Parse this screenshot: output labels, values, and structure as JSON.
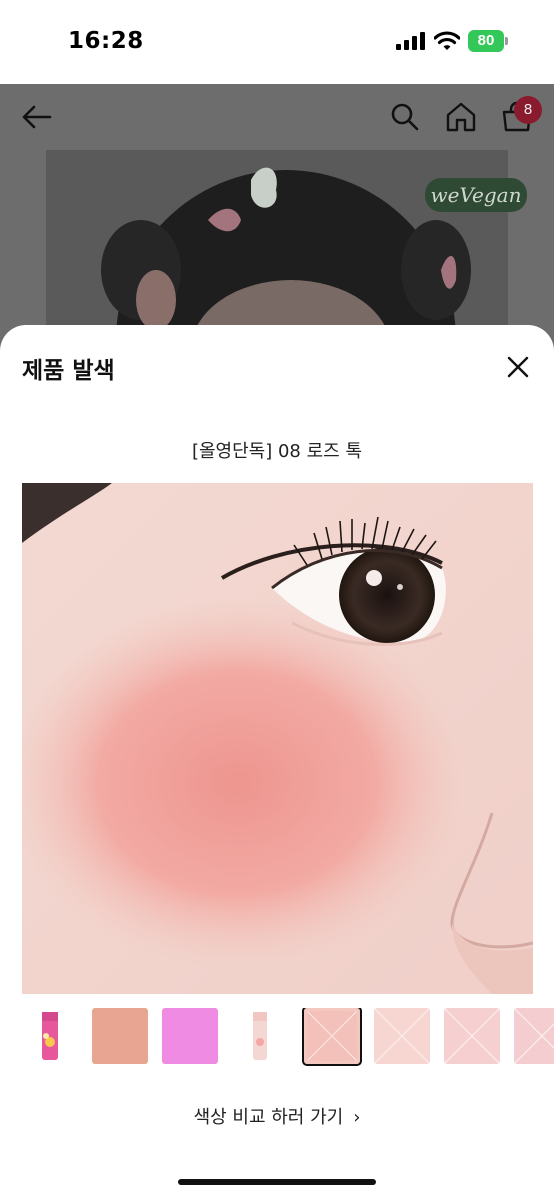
{
  "status_bar": {
    "time": "16:28",
    "battery": "80"
  },
  "background_page": {
    "cart_count": "8",
    "brand_badge": "weVegan"
  },
  "sheet": {
    "title": "제품 발색",
    "shade_name": "[올영단독] 08 로즈 톡",
    "compare_link": "색상 비교 하러 가기",
    "compare_chevron": "›"
  },
  "thumbnails": [
    {
      "kind": "product",
      "color": "#e6579c"
    },
    {
      "kind": "swatch",
      "color": "#e8a592"
    },
    {
      "kind": "swatch",
      "color": "#ef8be2"
    },
    {
      "kind": "product",
      "color": "#f1c6c2"
    },
    {
      "kind": "placeholder",
      "color": "#f3c8c0",
      "selected": true
    },
    {
      "kind": "placeholder",
      "color": "#f7d5d0"
    },
    {
      "kind": "placeholder",
      "color": "#f6cfd0"
    },
    {
      "kind": "placeholder",
      "color": "#f4cdd0"
    }
  ],
  "colors": {
    "dim_overlay": "#6d6d6d",
    "battery_green": "#34c759",
    "cart_badge": "#8a1a2e",
    "cheek_blush": "#ef9d98",
    "skin_base": "#f1d3cc"
  },
  "icons": [
    "back-arrow-icon",
    "search-icon",
    "home-icon",
    "cart-icon",
    "close-icon",
    "chevron-right-icon"
  ]
}
